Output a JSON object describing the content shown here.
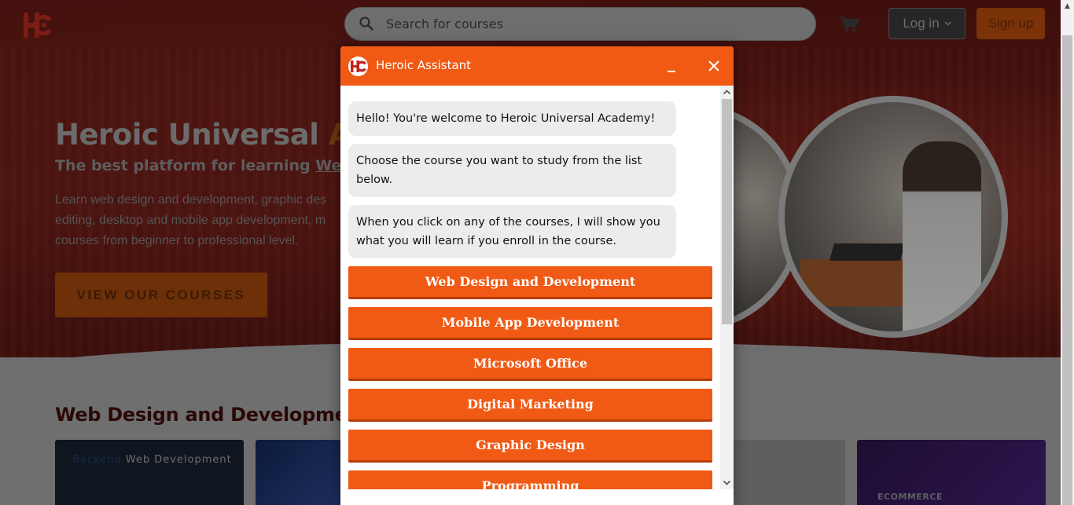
{
  "header": {
    "logo_text": "HC",
    "search_placeholder": "Search for courses",
    "login_label": "Log in",
    "signup_label": "Sign up"
  },
  "hero": {
    "title_part1": "Heroic Universal ",
    "title_part2": "Aca",
    "subtitle_prefix": "The best platform for learning ",
    "subtitle_link": "Web De",
    "desc_line1": "Learn web design and development, graphic des",
    "desc_line2": "editing, desktop and mobile app development, m",
    "desc_line3": "courses from beginner to professional level.",
    "cta_label": "VIEW OUR COURSES"
  },
  "section": {
    "title": "Web Design and Development",
    "card1_prefix": "Backend",
    "card1_suffix": " Web Development",
    "card4_label": "ECOMMERCE"
  },
  "chat": {
    "title": "Heroic Assistant",
    "messages": [
      "Hello! You're welcome to Heroic Universal Academy!",
      "Choose the course you want to study from the list below.",
      "When you click on any of the courses, I will show you what you will learn if you enroll in the course."
    ],
    "courses": [
      "Web Design and Development",
      "Mobile App Development",
      "Microsoft Office",
      "Digital Marketing",
      "Graphic Design",
      "Programming"
    ]
  },
  "colors": {
    "chat_accent": "#f05a15",
    "bubble_bg": "#ececec"
  }
}
